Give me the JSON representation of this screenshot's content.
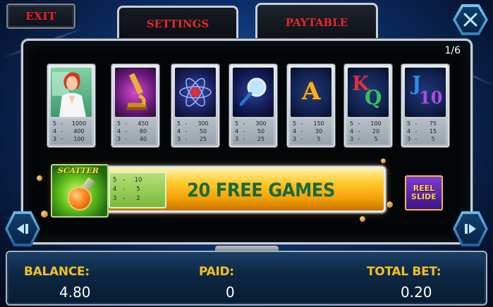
{
  "header": {
    "exit_label": "EXIT",
    "tabs": [
      {
        "label": "SETTINGS",
        "active": false
      },
      {
        "label": "PAYTABLE",
        "active": true
      }
    ]
  },
  "paytable": {
    "page_indicator": "1/6",
    "symbols": [
      {
        "name": "scientist-woman",
        "pays": [
          {
            "count": "5",
            "value": "1000"
          },
          {
            "count": "4",
            "value": "400"
          },
          {
            "count": "3",
            "value": "100"
          }
        ]
      },
      {
        "name": "microscope",
        "pays": [
          {
            "count": "5",
            "value": "450"
          },
          {
            "count": "4",
            "value": "80"
          },
          {
            "count": "3",
            "value": "40"
          }
        ]
      },
      {
        "name": "atom",
        "pays": [
          {
            "count": "5",
            "value": "300"
          },
          {
            "count": "4",
            "value": "50"
          },
          {
            "count": "3",
            "value": "25"
          }
        ]
      },
      {
        "name": "magnifying-glass",
        "pays": [
          {
            "count": "5",
            "value": "300"
          },
          {
            "count": "4",
            "value": "50"
          },
          {
            "count": "3",
            "value": "25"
          }
        ]
      },
      {
        "name": "ace",
        "glyph": "A",
        "pays": [
          {
            "count": "5",
            "value": "150"
          },
          {
            "count": "4",
            "value": "30"
          },
          {
            "count": "3",
            "value": "5"
          }
        ]
      },
      {
        "name": "king-queen",
        "glyph_1": "K",
        "glyph_2": "Q",
        "pays": [
          {
            "count": "5",
            "value": "100"
          },
          {
            "count": "4",
            "value": "20"
          },
          {
            "count": "3",
            "value": "5"
          }
        ]
      },
      {
        "name": "jack-ten",
        "glyph_1": "J",
        "glyph_2": "10",
        "pays": [
          {
            "count": "5",
            "value": "75"
          },
          {
            "count": "4",
            "value": "15"
          },
          {
            "count": "3",
            "value": "5"
          }
        ]
      }
    ],
    "scatter": {
      "label": "SCATTER",
      "pays": [
        {
          "count": "5",
          "value": "10"
        },
        {
          "count": "4",
          "value": "5"
        },
        {
          "count": "3",
          "value": "2"
        }
      ],
      "bonus_text": "20 FREE GAMES"
    },
    "reel_slide": {
      "line1": "REEL",
      "line2": "SLIDE"
    }
  },
  "footer": {
    "balance_label": "BALANCE:",
    "balance_value": "4.80",
    "paid_label": "PAID:",
    "paid_value": "0",
    "total_bet_label": "TOTAL BET:",
    "total_bet_value": "0.20"
  },
  "colors": {
    "tab_text": "#e8262a",
    "footer_label": "#f5c01c",
    "free_games_text": "#1a6a3e"
  }
}
